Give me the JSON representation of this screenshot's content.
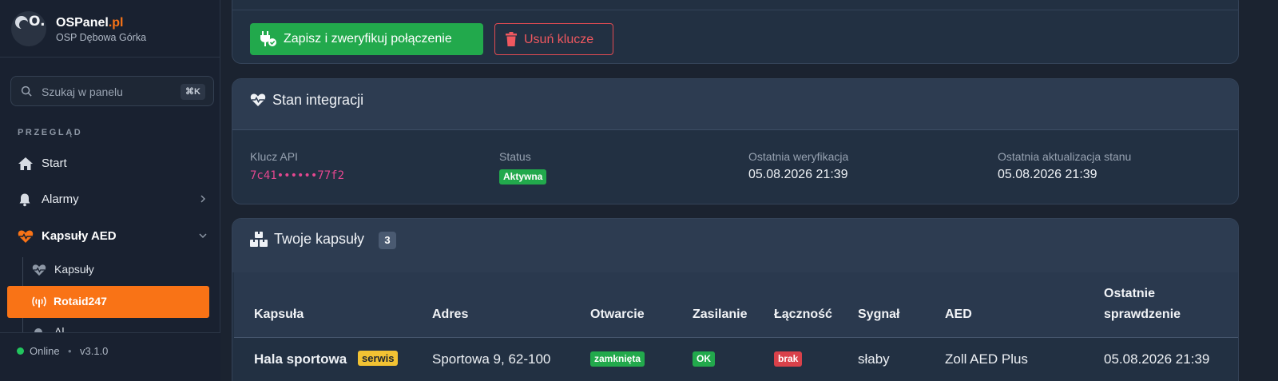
{
  "brand": {
    "name": "OSPanel",
    "tld": ".pl",
    "subtitle": "OSP Dębowa Górka"
  },
  "search": {
    "placeholder": "Szukaj w panelu",
    "shortcut": "⌘K"
  },
  "sidebar": {
    "section_label": "PRZEGLĄD",
    "items": [
      {
        "label": "Start",
        "icon": "home-icon"
      },
      {
        "label": "Alarmy",
        "icon": "bell-icon"
      },
      {
        "label": "Kapsuły AED",
        "icon": "heart-pulse-icon"
      }
    ],
    "subitems": [
      {
        "label": "Kapsuły",
        "icon": "heart-pulse-icon"
      },
      {
        "label": "Rotaid247",
        "icon": "antenna-icon"
      },
      {
        "label": "Al...",
        "icon": "gear-icon"
      }
    ],
    "footer": {
      "status": "Online",
      "separator": "•",
      "version": "v3.1.0"
    }
  },
  "actions": {
    "save_label": "Zapisz i zweryfikuj połączenie",
    "delete_label": "Usuń klucze"
  },
  "integration": {
    "title": "Stan integracji",
    "fields": [
      {
        "label": "Klucz API",
        "value": "7c41••••••77f2"
      },
      {
        "label": "Status",
        "value": "Aktywna"
      },
      {
        "label": "Ostatnia weryfikacja",
        "value": "05.08.2026 21:39"
      },
      {
        "label": "Ostatnia aktualizacja stanu",
        "value": "05.08.2026 21:39"
      }
    ]
  },
  "capsules": {
    "title": "Twoje kapsuły",
    "count": "3",
    "columns": [
      "Kapsuła",
      "Adres",
      "Otwarcie",
      "Zasilanie",
      "Łączność",
      "Sygnał",
      "AED",
      "Ostatnie",
      "sprawdzenie"
    ],
    "rows": [
      {
        "name": "Hala sportowa",
        "tag": "serwis",
        "address": "Sportowa 9, 62-100",
        "opening": "zamknięta",
        "power": "OK",
        "connectivity": "brak",
        "signal": "słaby",
        "aed": "Zoll AED Plus",
        "checked": "05.08.2026 21:39"
      }
    ]
  },
  "colors": {
    "accent": "#f97316",
    "success": "#22a94c",
    "danger": "#d9414a",
    "warning": "#f2c233"
  }
}
